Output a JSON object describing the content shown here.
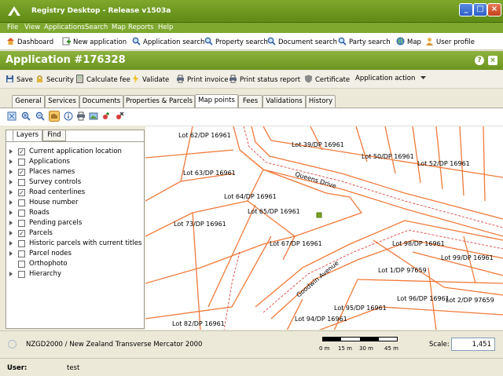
{
  "window": {
    "title": "Registry Desktop - Release v1503a"
  },
  "menu": [
    "File",
    "View",
    "Applications",
    "Search",
    "Map",
    "Reports",
    "Help"
  ],
  "toolbar": [
    {
      "label": "Dashboard",
      "icon": "home-icon"
    },
    {
      "label": "New application",
      "icon": "plus-icon"
    },
    {
      "label": "Application search",
      "icon": "search-icon"
    },
    {
      "label": "Property search",
      "icon": "search-icon"
    },
    {
      "label": "Document search",
      "icon": "search-icon"
    },
    {
      "label": "Party search",
      "icon": "search-icon"
    },
    {
      "label": "Map",
      "icon": "globe-icon"
    },
    {
      "label": "User profile",
      "icon": "user-icon"
    }
  ],
  "header": {
    "title": "Application #176328",
    "help": "?",
    "close": "×"
  },
  "actions": [
    {
      "label": "Save",
      "icon": "disk-icon"
    },
    {
      "label": "Security",
      "icon": "lock-icon"
    },
    {
      "label": "Calculate fee",
      "icon": "calculator-icon"
    },
    {
      "label": "Validate",
      "icon": "lightning-icon"
    },
    {
      "label": "Print invoice",
      "icon": "printer-icon"
    },
    {
      "label": "Print status report",
      "icon": "printer-icon"
    },
    {
      "label": "Certificate",
      "icon": "shield-icon"
    },
    {
      "label": "Application action",
      "icon": "dropdown-arrow-icon"
    }
  ],
  "tabs": [
    "General",
    "Services",
    "Documents",
    "Properties & Parcels",
    "Map points",
    "Fees",
    "Validations",
    "History"
  ],
  "active_tab": "Map points",
  "panel_tabs": [
    "Layers",
    "Find"
  ],
  "layers": [
    {
      "label": "Current application location",
      "checked": true
    },
    {
      "label": "Applications",
      "checked": false
    },
    {
      "label": "Places names",
      "checked": true
    },
    {
      "label": "Survey controls",
      "checked": false
    },
    {
      "label": "Road centerlines",
      "checked": true
    },
    {
      "label": "House number",
      "checked": false
    },
    {
      "label": "Roads",
      "checked": false
    },
    {
      "label": "Pending parcels",
      "checked": false
    },
    {
      "label": "Parcels",
      "checked": true
    },
    {
      "label": "Historic parcels with current titles",
      "checked": false
    },
    {
      "label": "Parcel nodes",
      "checked": false
    },
    {
      "label": "Orthophoto",
      "checked": false
    },
    {
      "label": "Hierarchy",
      "checked": false
    }
  ],
  "map_labels": [
    "Lot 62/DP 16961",
    "Lot 39/DP 16961",
    "Lot 50/DP 16961",
    "Lot 52/DP 16961",
    "Lot 63/DP 16961",
    "Lot 64/DP 16961",
    "Lot 65/DP 16961",
    "Lot 73/DP 16961",
    "Lot 67/DP 16961",
    "Lot 98/DP 16961",
    "Lot 99/DP 16961",
    "Lot 1/DP 97659",
    "Lot 96/DP 16961",
    "Lot 2/DP 97659",
    "Lot 95/DP 16961",
    "Lot 94/DP 16961",
    "Lot 82/DP 16961"
  ],
  "streets": [
    "Queens Drive",
    "Goodwin Avenue"
  ],
  "footer": {
    "projection": "NZGD2000 / New Zealand Transverse Mercator 2000",
    "scale_ticks": [
      "0 m",
      "15 m",
      "30 m",
      "45 m"
    ],
    "scale_label": "Scale:",
    "scale_value": "1,451"
  },
  "status": {
    "user_label": "User:",
    "user_value": "test"
  },
  "colors": {
    "brand": "#7ea82e",
    "parcel_line": "#f07a3a",
    "marker": "#7aa020"
  }
}
